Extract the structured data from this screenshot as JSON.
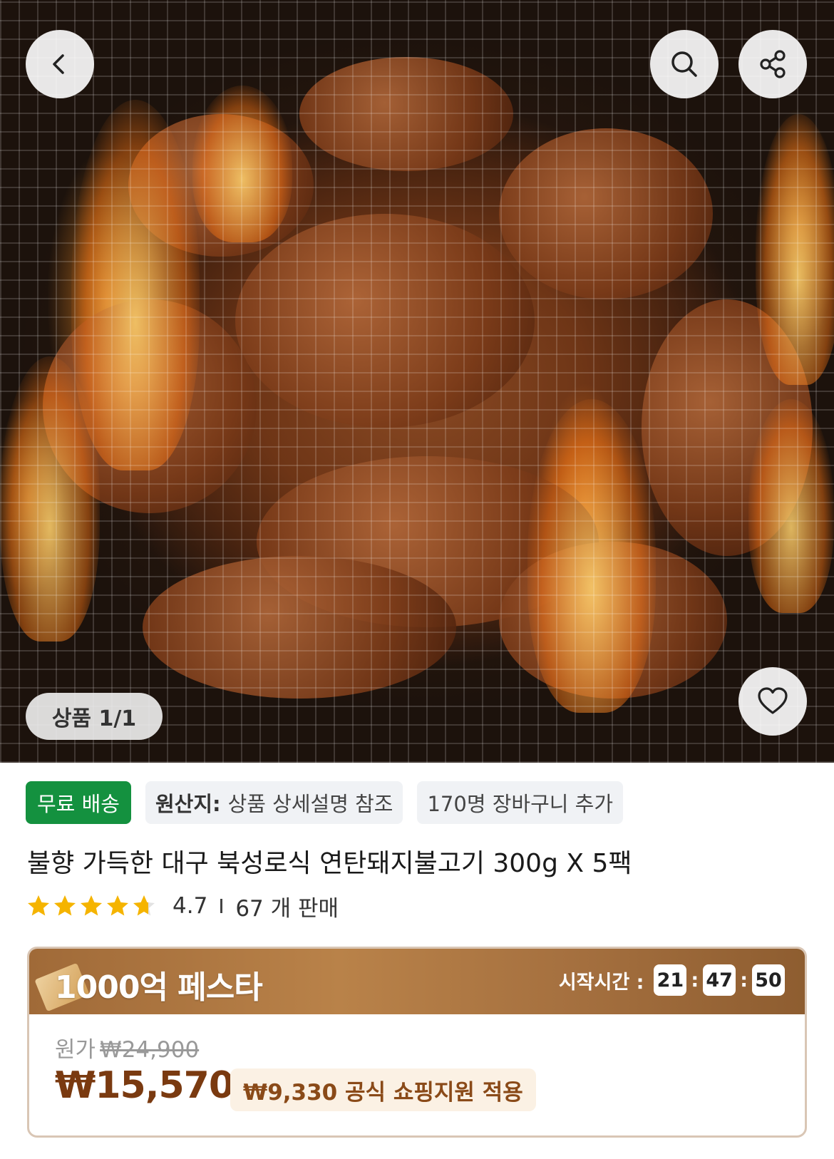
{
  "gallery": {
    "counter": "상품 1/1",
    "image_description_icon": "grilled-pork-bulgogi-photo"
  },
  "header": {
    "back_icon": "chevron-left-icon",
    "search_icon": "search-icon",
    "share_icon": "share-icon",
    "wishlist_icon": "heart-icon"
  },
  "tags": {
    "free_shipping": "무료 배송",
    "origin_label": "원산지:",
    "origin_value": "상품 상세설명 참조",
    "cart_count": "170명 장바구니 추가"
  },
  "product": {
    "title": "불향 가득한 대구 북성로식 연탄돼지불고기 300g X 5팩",
    "rating": "4.7",
    "rating_value": 4.7,
    "sold": "67 개 판매"
  },
  "promo": {
    "title": "1000억 페스타",
    "timer_label": "시작시간 :",
    "hours": "21",
    "minutes": "47",
    "seconds": "50",
    "original_label": "원가",
    "original_price": "₩24,900",
    "price": "₩15,570",
    "support": "₩9,330 공식 쇼핑지원 적용"
  },
  "colors": {
    "free_shipping_bg": "#14913f",
    "promo_header": "#a87440",
    "price": "#7a3a10",
    "star": "#f5b400"
  }
}
